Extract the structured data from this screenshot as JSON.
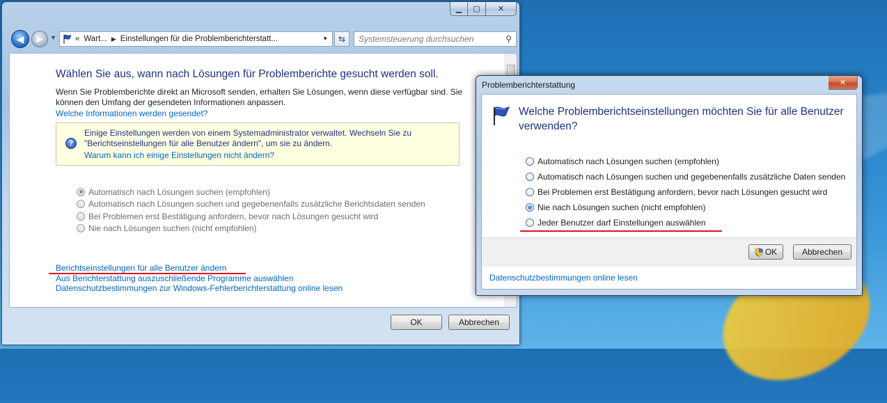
{
  "main_window": {
    "address_crumbs": [
      "«",
      "Wart...",
      "Einstellungen für die Problemberichterstatt..."
    ],
    "search_placeholder": "Systemsteuerung durchsuchen",
    "heading": "Wählen Sie aus, wann nach Lösungen für Problemberichte gesucht werden soll.",
    "description": "Wenn Sie Problemberichte direkt an Microsoft senden, erhalten Sie Lösungen, wenn diese verfügbar sind. Sie können den Umfang der gesendeten Informationen anpassen.",
    "info_link": "Welche Informationen werden gesendet?",
    "notice": {
      "text": "Einige Einstellungen werden von einem Systemadministrator verwaltet. Wechseln Sie zu \"Berichtseinstellungen für alle Benutzer ändern\", um sie zu ändern.",
      "link": "Warum kann ich einige Einstellungen nicht ändern?"
    },
    "options": [
      {
        "label": "Automatisch nach Lösungen suchen (empfohlen)",
        "checked": true
      },
      {
        "label": "Automatisch nach Lösungen suchen und gegebenenfalls zusätzliche Berichtsdaten senden",
        "checked": false
      },
      {
        "label": "Bei Problemen erst Bestätigung anfordern, bevor nach Lösungen gesucht wird",
        "checked": false
      },
      {
        "label": "Nie nach Lösungen suchen (nicht empfohlen)",
        "checked": false
      }
    ],
    "links": [
      "Berichtseinstellungen für alle Benutzer ändern",
      "Aus Berichterstattung auszuschließende Programme auswählen",
      "Datenschutzbestimmungen zur Windows-Fehlerberichterstattung online lesen"
    ],
    "ok_label": "OK",
    "cancel_label": "Abbrechen"
  },
  "dialog": {
    "title": "Problemberichterstattung",
    "heading": "Welche Problemberichtseinstellungen möchten Sie für alle Benutzer verwenden?",
    "options": [
      {
        "label": "Automatisch nach Lösungen suchen (empfohlen)",
        "checked": false
      },
      {
        "label": "Automatisch nach Lösungen suchen und gegebenenfalls zusätzliche Daten senden",
        "checked": false
      },
      {
        "label": "Bei Problemen erst Bestätigung anfordern, bevor nach Lösungen gesucht wird",
        "checked": false
      },
      {
        "label": "Nie nach Lösungen suchen (nicht empfohlen)",
        "checked": true
      },
      {
        "label": "Jeder Benutzer darf Einstellungen auswählen",
        "checked": false
      }
    ],
    "ok_label": "OK",
    "cancel_label": "Abbrechen",
    "privacy_link": "Datenschutzbestimmungen online lesen"
  },
  "colors": {
    "heading_blue": "#1e3287",
    "link_blue": "#0066cc",
    "annotation_red": "#e0131c",
    "notice_background": "#ffffe1"
  }
}
